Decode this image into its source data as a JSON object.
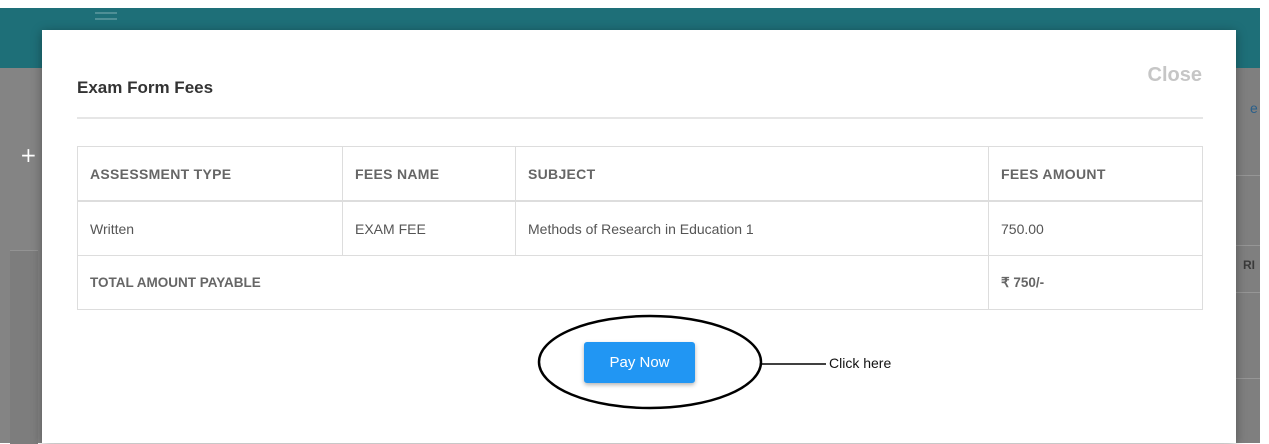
{
  "modal": {
    "title": "Exam Form Fees",
    "close_label": "Close"
  },
  "table": {
    "headers": [
      "ASSESSMENT TYPE",
      "FEES NAME",
      "SUBJECT",
      "FEES AMOUNT"
    ],
    "rows": [
      [
        "Written",
        "EXAM FEE",
        "Methods of Research in Education 1",
        "750.00"
      ]
    ],
    "total_label": "TOTAL AMOUNT PAYABLE",
    "total_value": "₹ 750/-"
  },
  "pay_button": {
    "label": "Pay Now"
  },
  "annotation": {
    "text": "Click here"
  },
  "background": {
    "right_text_top": "e",
    "right_text_mid": "RI"
  },
  "colors": {
    "topbar": "#1e6f78",
    "overlay": "#848484",
    "primary_button": "#2196f3",
    "close_text": "#c6c6c6"
  }
}
